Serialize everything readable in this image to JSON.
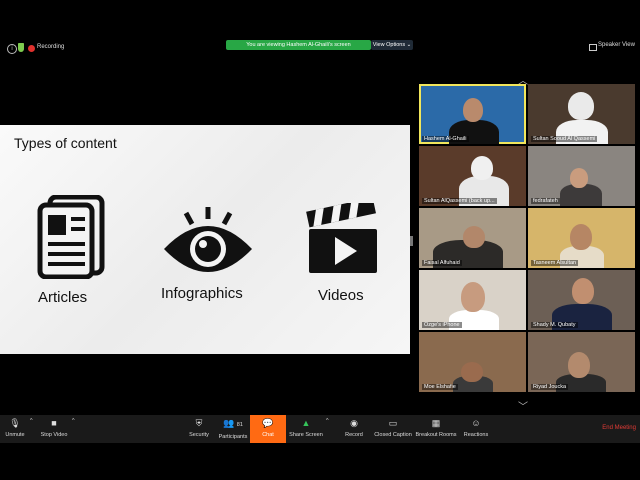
{
  "topbar": {
    "recording_label": "Recording",
    "banner_text": "You are viewing Hashem Al-Ghaili's screen",
    "view_options_label": "View Options",
    "speaker_view_label": "Speaker View"
  },
  "slide": {
    "title": "Types of content",
    "items": [
      {
        "label": "Articles",
        "icon": "newspaper-icon"
      },
      {
        "label": "Infographics",
        "icon": "eye-icon"
      },
      {
        "label": "Videos",
        "icon": "clapperboard-icon"
      }
    ]
  },
  "gallery": {
    "participants": [
      {
        "name": "Hashem Al-Ghaili"
      },
      {
        "name": "Sultan Sooud Al Qassemi"
      },
      {
        "name": "Sultan AlQassemi (back up..."
      },
      {
        "name": "fedrafateh"
      },
      {
        "name": "Faisal Alfuhaid"
      },
      {
        "name": "Tasneem Alsultan"
      },
      {
        "name": "Ozge's iPhone"
      },
      {
        "name": "Shady M. Qubaty"
      },
      {
        "name": "Moe Elshafie"
      },
      {
        "name": "Riyad Joucka"
      }
    ]
  },
  "toolbar": {
    "unmute": "Unmute",
    "stop_video": "Stop Video",
    "security": "Security",
    "participants": "Participants",
    "participants_count": "81",
    "chat": "Chat",
    "share_screen": "Share Screen",
    "record": "Record",
    "closed_caption": "Closed Caption",
    "breakout_rooms": "Breakout Rooms",
    "reactions": "Reactions",
    "end_meeting": "End Meeting"
  },
  "colors": {
    "banner_green": "#28a745",
    "chat_orange": "#ff6a13",
    "end_meeting_red": "#e23b36",
    "active_speaker_yellow": "#f1e65c"
  }
}
